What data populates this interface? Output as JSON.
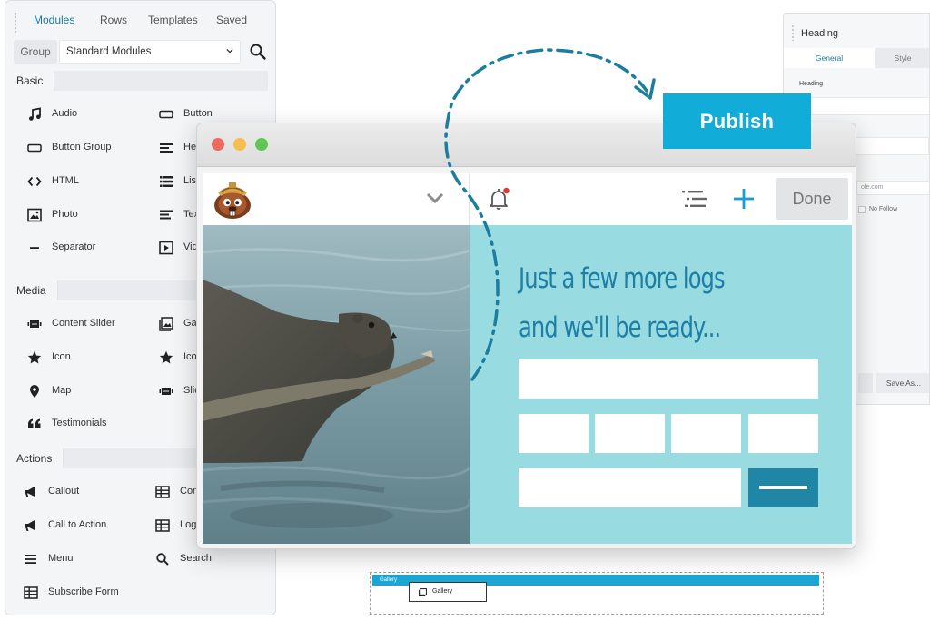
{
  "modules_panel": {
    "tabs": [
      "Modules",
      "Rows",
      "Templates",
      "Saved"
    ],
    "group_label": "Group",
    "group_value": "Standard Modules",
    "sections": [
      {
        "title": "Basic",
        "items": [
          {
            "label": "Audio",
            "icon": "music-note-icon"
          },
          {
            "label": "Button",
            "icon": "button-icon"
          },
          {
            "label": "Button Group",
            "icon": "button-group-icon"
          },
          {
            "label": "Head",
            "icon": "heading-icon"
          },
          {
            "label": "HTML",
            "icon": "code-icon"
          },
          {
            "label": "List",
            "icon": "list-icon"
          },
          {
            "label": "Photo",
            "icon": "photo-icon"
          },
          {
            "label": "Text",
            "icon": "text-icon"
          },
          {
            "label": "Separator",
            "icon": "separator-icon"
          },
          {
            "label": "Video",
            "icon": "video-icon"
          }
        ]
      },
      {
        "title": "Media",
        "items": [
          {
            "label": "Content Slider",
            "icon": "slider-icon"
          },
          {
            "label": "Galle",
            "icon": "gallery-icon"
          },
          {
            "label": "Icon",
            "icon": "star-icon"
          },
          {
            "label": "Icon",
            "icon": "star-icon"
          },
          {
            "label": "Map",
            "icon": "map-pin-icon"
          },
          {
            "label": "Slide",
            "icon": "slider-icon"
          },
          {
            "label": "Testimonials",
            "icon": "quote-icon"
          }
        ]
      },
      {
        "title": "Actions",
        "items": [
          {
            "label": "Callout",
            "icon": "megaphone-icon"
          },
          {
            "label": "Conta",
            "icon": "form-icon"
          },
          {
            "label": "Call to Action",
            "icon": "megaphone-icon"
          },
          {
            "label": "Login",
            "icon": "form-icon"
          },
          {
            "label": "Menu",
            "icon": "menu-icon"
          },
          {
            "label": "Search",
            "icon": "search-icon"
          },
          {
            "label": "Subscribe Form",
            "icon": "form-icon"
          }
        ]
      }
    ]
  },
  "settings_panel": {
    "title": "Heading",
    "tabs": [
      "General",
      "Style"
    ],
    "field_label": "Heading",
    "url_fragment": "ole.com",
    "nofollow_label": "No Follow",
    "save_as_label": "Save As..."
  },
  "drop_zone": {
    "bar_label": "Gallery",
    "chip_label": "Gallery"
  },
  "publish": {
    "label": "Publish"
  },
  "site": {
    "done_label": "Done",
    "headline_line1": "Just a few more logs",
    "headline_line2": "and we'll be ready..."
  },
  "colors": {
    "accent": "#12acd9",
    "hero_bg": "#98dbe0",
    "headline": "#1d7fa5",
    "submit": "#1f86a5",
    "arrow": "#1b7ea0"
  }
}
